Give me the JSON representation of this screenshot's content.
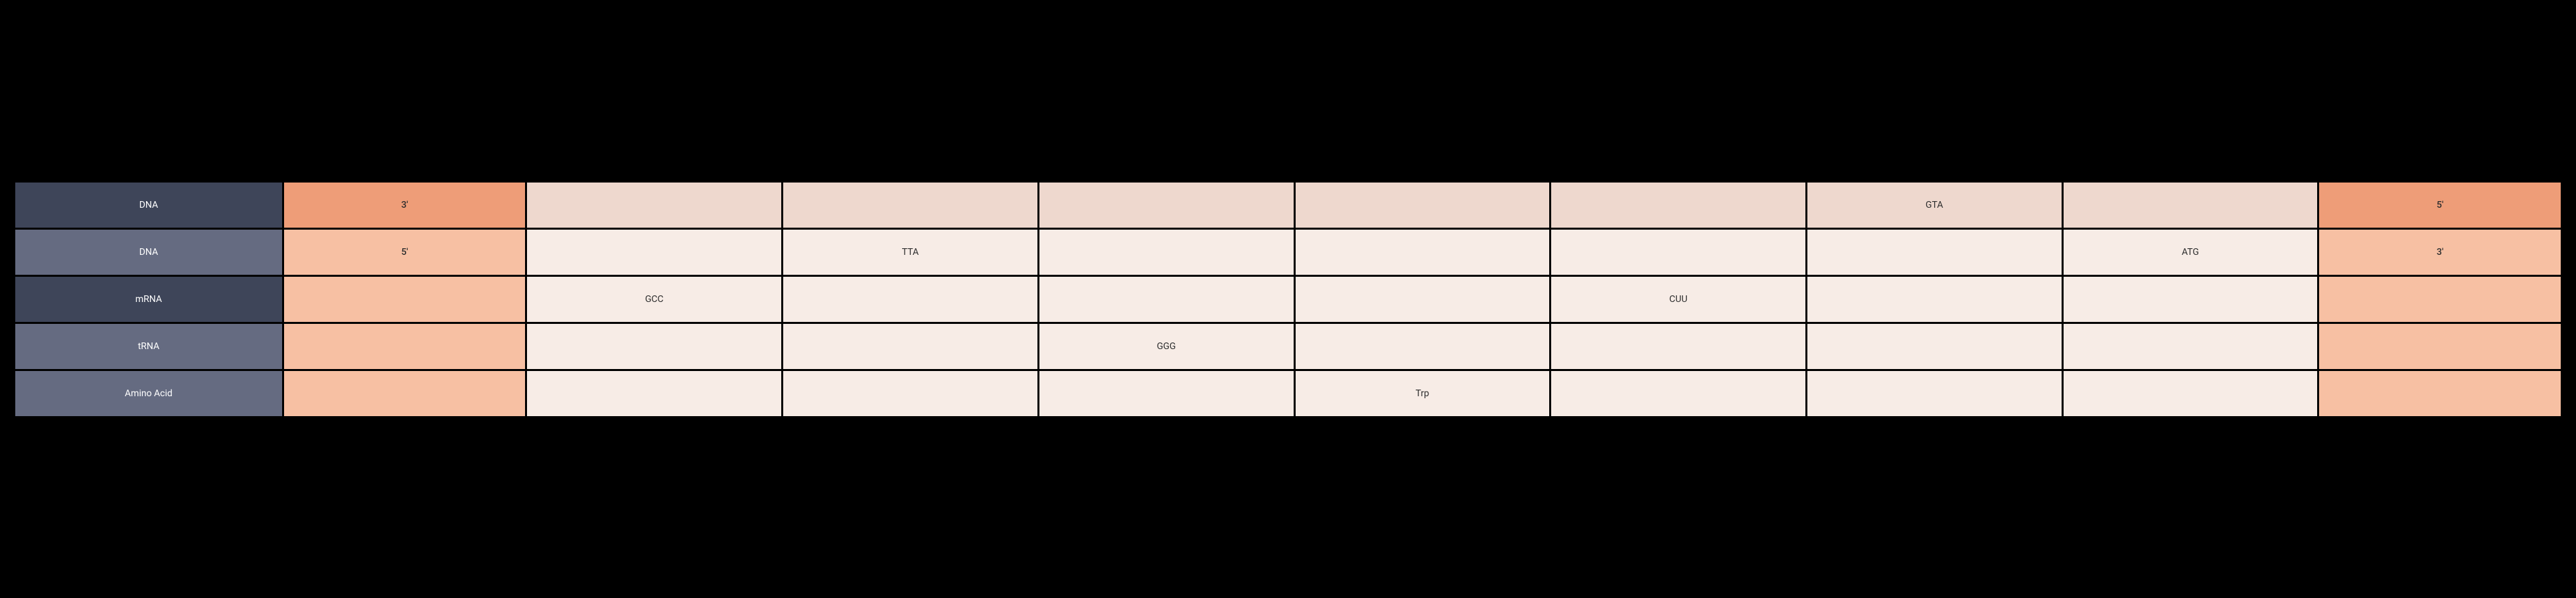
{
  "rows": [
    {
      "label": "DNA",
      "left_end": "3'",
      "right_end": "5'",
      "cells": [
        "",
        "",
        "",
        "",
        "",
        "GTA",
        ""
      ],
      "header_class": "hdr-dark",
      "end_class": "end-dark",
      "body_class": "body-dark"
    },
    {
      "label": "DNA",
      "left_end": "5'",
      "right_end": "3'",
      "cells": [
        "",
        "TTA",
        "",
        "",
        "",
        "",
        "ATG"
      ],
      "header_class": "hdr-mid",
      "end_class": "end-light",
      "body_class": "body-light"
    },
    {
      "label": "mRNA",
      "left_end": "",
      "right_end": "",
      "cells": [
        "GCC",
        "",
        "",
        "",
        "CUU",
        "",
        ""
      ],
      "header_class": "hdr-dark",
      "end_class": "end-light",
      "body_class": "body-light"
    },
    {
      "label": "tRNA",
      "left_end": "",
      "right_end": "",
      "cells": [
        "",
        "",
        "GGG",
        "",
        "",
        "",
        ""
      ],
      "header_class": "hdr-mid",
      "end_class": "end-light",
      "body_class": "body-light"
    },
    {
      "label": "Amino Acid",
      "left_end": "",
      "right_end": "",
      "cells": [
        "",
        "",
        "",
        "Trp",
        "",
        "",
        ""
      ],
      "header_class": "hdr-mid",
      "end_class": "end-light",
      "body_class": "body-light"
    }
  ]
}
